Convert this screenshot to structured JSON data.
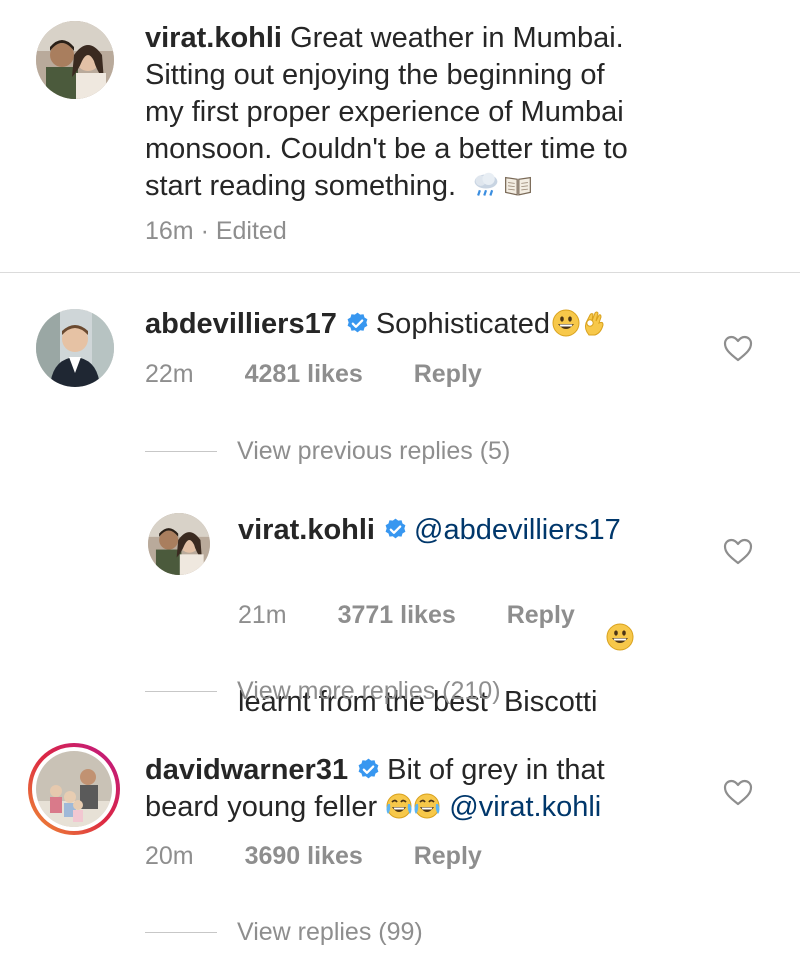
{
  "caption": {
    "username": "virat.kohli",
    "text_line1": "Great weather in Mumbai.",
    "text_line2": "Sitting out enjoying the beginning of",
    "text_line3": "my first proper experience of Mumbai",
    "text_line4": "monsoon. Couldn't be a better time to",
    "text_line5": "start reading something.",
    "meta": "16m · Edited"
  },
  "comments": [
    {
      "username": "abdevilliers17",
      "verified": true,
      "text": "Sophisticated",
      "time": "22m",
      "likes": "4281 likes",
      "reply_label": "Reply",
      "view_replies": "View previous replies (5)"
    },
    {
      "username": "virat.kohli",
      "verified": true,
      "mention": "@abdevilliers17",
      "text": "learnt from the best  Biscotti",
      "time": "21m",
      "likes": "3771 likes",
      "reply_label": "Reply",
      "view_replies": "View more replies (210)"
    },
    {
      "username": "davidwarner31",
      "verified": true,
      "text_line1": "Bit of grey in that",
      "text_line2": "beard young feller",
      "mention": "@virat.kohli",
      "time": "20m",
      "likes": "3690 likes",
      "reply_label": "Reply",
      "view_replies": "View replies (99)"
    }
  ],
  "icons": {
    "verified": "verified-badge-icon",
    "heart": "heart-outline-icon",
    "rain": "cloud-rain-emoji",
    "book": "open-book-emoji",
    "grin": "grinning-face-emoji",
    "ok": "ok-hand-emoji",
    "joy": "tears-of-joy-emoji"
  },
  "colors": {
    "text": "#262626",
    "secondary": "#8e8e8e",
    "verified": "#3897f0",
    "mention": "#00376b",
    "story_ring_start": "#f09433",
    "story_ring_end": "#bc1888"
  }
}
